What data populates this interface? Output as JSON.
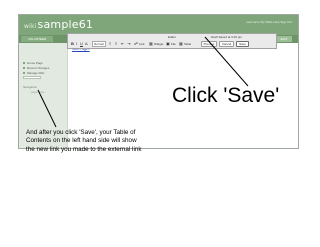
{
  "site": {
    "logo_prefix": "wiki",
    "logo_text": "sample61",
    "user_links": "username   My Wikis   Help   Sign Out"
  },
  "nav": {
    "tabs": [
      {
        "label": "VOLUNTEER SCHOOLS"
      },
      {
        "label": "PAGE"
      },
      {
        "label": "DISCUSSION"
      },
      {
        "label": "HISTORY"
      },
      {
        "label": "NOTIFY ME"
      }
    ],
    "edit_label": "EDIT"
  },
  "sidebar": {
    "items": [
      {
        "label": "Home Page"
      },
      {
        "label": "Recent Changes"
      },
      {
        "label": "Manage Wiki"
      }
    ],
    "search_label": "Search",
    "section_heading": "Navigation",
    "section_sub": "- page links -"
  },
  "content": {
    "link_text": "Wiki Page!!"
  },
  "editor": {
    "title": "Editor",
    "draft_status": "Draft Saved at 3:10 pm",
    "style_select": "Normal",
    "link_label": "Link",
    "widget_label": "Widget",
    "file_label": "File",
    "table_label": "Table",
    "preview_label": "Preview",
    "cancel_label": "Cancel",
    "save_label": "Save"
  },
  "annotations": {
    "click_save": "Click 'Save'",
    "note": "And after you click 'Save', your Table of Contents on the left hand side will show the new link you made to the external link"
  }
}
